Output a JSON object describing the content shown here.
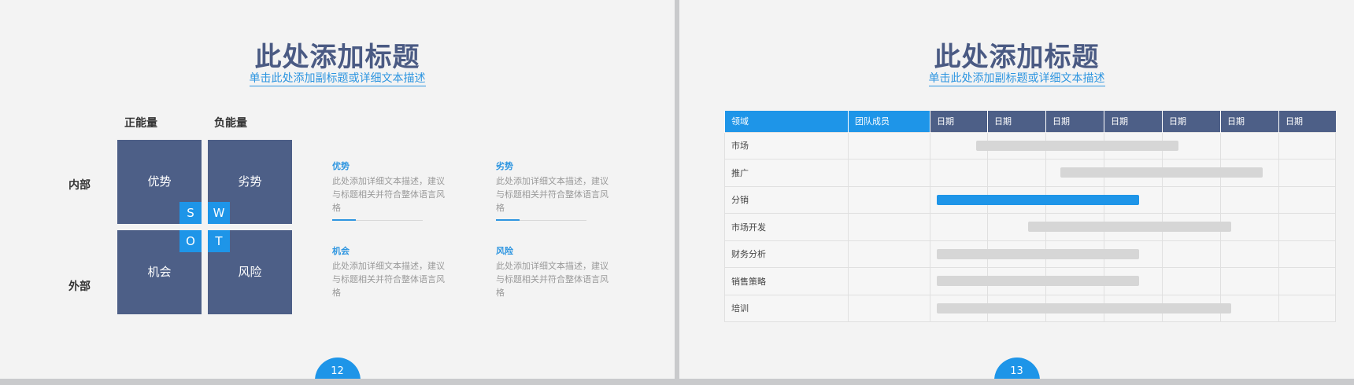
{
  "slide12": {
    "title": "此处添加标题",
    "subtitle": "单击此处添加副标题或详细文本描述",
    "page_number": "12",
    "col_labels": [
      "正能量",
      "负能量"
    ],
    "row_labels": [
      "内部",
      "外部"
    ],
    "quadrants": [
      "优势",
      "劣势",
      "机会",
      "风险"
    ],
    "letters": [
      "S",
      "W",
      "O",
      "T"
    ],
    "descriptions": [
      {
        "title": "优势",
        "text": "此处添加详细文本描述，建议与标题相关并符合整体语言风格"
      },
      {
        "title": "劣势",
        "text": "此处添加详细文本描述，建议与标题相关并符合整体语言风格"
      },
      {
        "title": "机会",
        "text": "此处添加详细文本描述，建议与标题相关并符合整体语言风格"
      },
      {
        "title": "风险",
        "text": "此处添加详细文本描述，建议与标题相关并符合整体语言风格"
      }
    ]
  },
  "slide13": {
    "title": "此处添加标题",
    "subtitle": "单击此处添加副标题或详细文本描述",
    "page_number": "13",
    "headers": [
      "领域",
      "团队成员",
      "日期",
      "日期",
      "日期",
      "日期",
      "日期",
      "日期",
      "日期"
    ],
    "rows": [
      "市场",
      "推广",
      "分销",
      "市场开发",
      "财务分析",
      "销售策略",
      "培训"
    ],
    "bars": [
      {
        "row": "市场",
        "start": 0.8,
        "end": 4.3,
        "highlight": false
      },
      {
        "row": "推广",
        "start": 2.25,
        "end": 5.75,
        "highlight": false
      },
      {
        "row": "分销",
        "start": 0.12,
        "end": 3.62,
        "highlight": true
      },
      {
        "row": "市场开发",
        "start": 1.7,
        "end": 5.2,
        "highlight": false
      },
      {
        "row": "财务分析",
        "start": 0.12,
        "end": 3.62,
        "highlight": false
      },
      {
        "row": "销售策略",
        "start": 0.12,
        "end": 3.62,
        "highlight": false
      },
      {
        "row": "培训",
        "start": 0.12,
        "end": 5.2,
        "highlight": false
      }
    ],
    "colors": {
      "accent": "#1e95e8",
      "header": "#4d5f87",
      "bar": "#d6d6d6"
    }
  }
}
